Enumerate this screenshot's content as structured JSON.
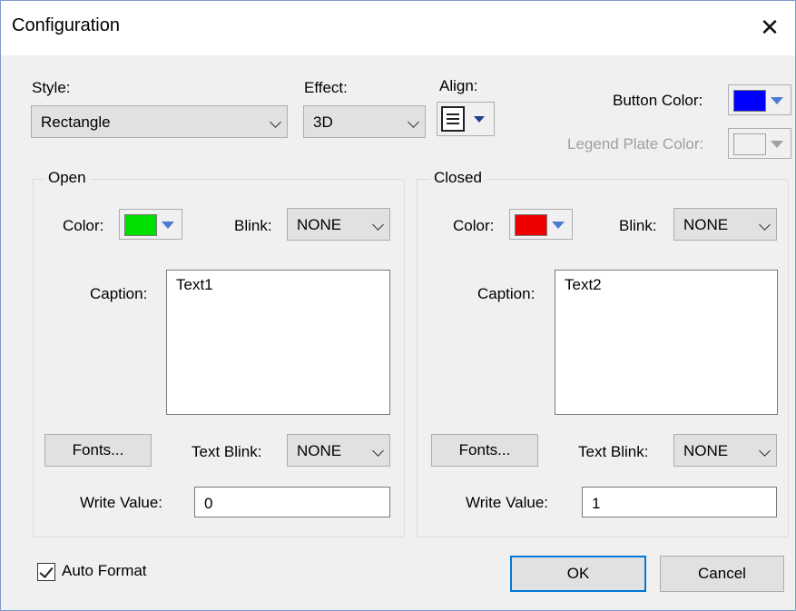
{
  "window": {
    "title": "Configuration",
    "close_glyph": "✕"
  },
  "top": {
    "style_label": "Style:",
    "style_value": "Rectangle",
    "effect_label": "Effect:",
    "effect_value": "3D",
    "align_label": "Align:",
    "button_color_label": "Button Color:",
    "button_color": "#0000ff",
    "legend_plate_color_label": "Legend Plate Color:"
  },
  "open": {
    "legend": "Open",
    "color_label": "Color:",
    "color": "#00e000",
    "blink_label": "Blink:",
    "blink_value": "NONE",
    "caption_label": "Caption:",
    "caption_value": "Text1",
    "fonts_label": "Fonts...",
    "text_blink_label": "Text Blink:",
    "text_blink_value": "NONE",
    "write_value_label": "Write Value:",
    "write_value": "0"
  },
  "closed": {
    "legend": "Closed",
    "color_label": "Color:",
    "color": "#ee0000",
    "blink_label": "Blink:",
    "blink_value": "NONE",
    "caption_label": "Caption:",
    "caption_value": "Text2",
    "fonts_label": "Fonts...",
    "text_blink_label": "Text Blink:",
    "text_blink_value": "NONE",
    "write_value_label": "Write Value:",
    "write_value": "1"
  },
  "footer": {
    "auto_format_label": "Auto Format",
    "auto_format_checked": true,
    "ok_label": "OK",
    "cancel_label": "Cancel"
  }
}
